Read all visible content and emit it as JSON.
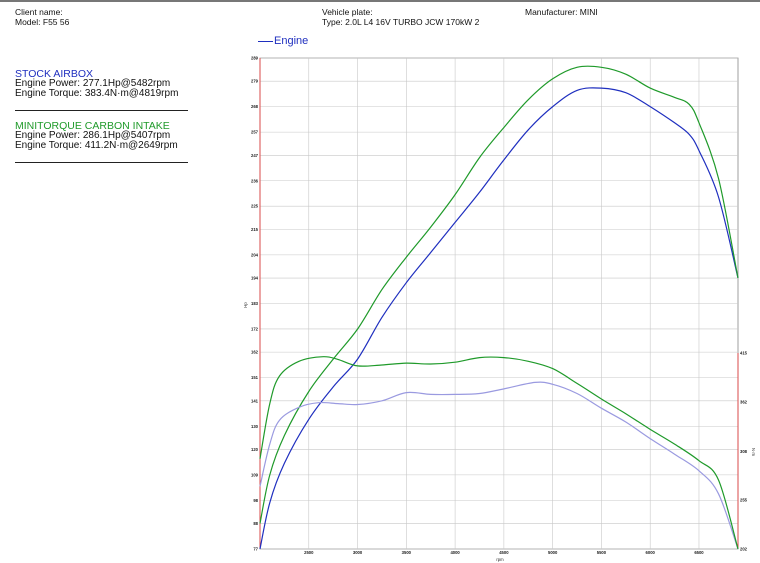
{
  "header": {
    "client_name_label": "Client name:",
    "model": "Model: F55 56",
    "vehicle_plate_label": "Vehicle plate:",
    "type": "Type: 2.0L L4 16V TURBO JCW 170kW 2",
    "manufacturer": "Manufacturer: MINI"
  },
  "legend_label": "Engine",
  "runs": [
    {
      "name": "STOCK AIRBOX",
      "power": "Engine Power: 277.1Hp@5482rpm",
      "torque": "Engine Torque: 383.4N·m@4819rpm",
      "color": "#1f2fbf"
    },
    {
      "name": "MINITORQUE CARBON INTAKE",
      "power": "Engine Power: 286.1Hp@5407rpm",
      "torque": "Engine Torque: 411.2N·m@2649rpm",
      "color": "#1f9a2a"
    }
  ],
  "chart_data": {
    "type": "line",
    "xlabel": "rpm",
    "ylabel_left": "Hp",
    "ylabel_right": "N·m",
    "xlim": [
      2000,
      6900
    ],
    "x_ticks": [
      "2500",
      "3000",
      "3500",
      "4000",
      "4500",
      "5000",
      "5500",
      "6000",
      "6500"
    ],
    "y_left_ticks": [
      "77",
      "88",
      "98",
      "109",
      "120",
      "130",
      "141",
      "151",
      "162",
      "172",
      "183",
      "194",
      "204",
      "215",
      "225",
      "236",
      "247",
      "257",
      "268",
      "279",
      "289"
    ],
    "y_right_ticks": [
      "202",
      "255",
      "308",
      "362",
      "415"
    ],
    "grid": true,
    "series": [
      {
        "name": "STOCK AIRBOX",
        "quantity": "power",
        "axis": "left",
        "color": "#1f2fbf",
        "x": [
          2000,
          2100,
          2250,
          2500,
          2750,
          3000,
          3250,
          3500,
          3750,
          4000,
          4250,
          4500,
          4750,
          5000,
          5250,
          5500,
          5750,
          6000,
          6250,
          6400,
          6500,
          6700,
          6900
        ],
        "y": [
          77,
          97,
          114,
          133,
          147,
          159,
          177,
          192,
          205,
          218,
          231,
          245,
          258,
          268,
          275,
          276,
          274,
          268,
          261,
          256,
          249,
          229,
          194
        ]
      },
      {
        "name": "MINITORQUE CARBON INTAKE",
        "quantity": "power",
        "axis": "left",
        "color": "#1f9a2a",
        "x": [
          2000,
          2100,
          2250,
          2500,
          2750,
          3000,
          3250,
          3500,
          3750,
          4000,
          4250,
          4500,
          4750,
          5000,
          5250,
          5500,
          5750,
          6000,
          6250,
          6400,
          6500,
          6700,
          6900
        ],
        "y": [
          88,
          109,
          126,
          145,
          159,
          172,
          189,
          203,
          216,
          230,
          246,
          259,
          271,
          280,
          285,
          285,
          282,
          276,
          272,
          269,
          261,
          237,
          194
        ]
      },
      {
        "name": "STOCK AIRBOX",
        "quantity": "torque",
        "axis": "right",
        "color": "#9a9ae0",
        "x": [
          2000,
          2100,
          2200,
          2400,
          2600,
          2800,
          3000,
          3250,
          3500,
          3750,
          4000,
          4250,
          4500,
          4819,
          5000,
          5250,
          5500,
          5750,
          6000,
          6250,
          6500,
          6700,
          6900
        ],
        "y": [
          270,
          316,
          342,
          356,
          361,
          360,
          359,
          363,
          372,
          370,
          370,
          371,
          376,
          383,
          381,
          371,
          355,
          340,
          322,
          305,
          287,
          262,
          202
        ]
      },
      {
        "name": "MINITORQUE CARBON INTAKE",
        "quantity": "torque",
        "axis": "right",
        "color": "#1f9a2a",
        "x": [
          2000,
          2100,
          2200,
          2400,
          2649,
          2800,
          3000,
          3250,
          3500,
          3750,
          4000,
          4250,
          4500,
          4750,
          5000,
          5250,
          5500,
          5750,
          6000,
          6250,
          6500,
          6700,
          6900
        ],
        "y": [
          300,
          360,
          390,
          406,
          411,
          408,
          401,
          402,
          404,
          403,
          405,
          410,
          410,
          406,
          398,
          382,
          365,
          349,
          332,
          316,
          298,
          277,
          202
        ]
      }
    ]
  }
}
